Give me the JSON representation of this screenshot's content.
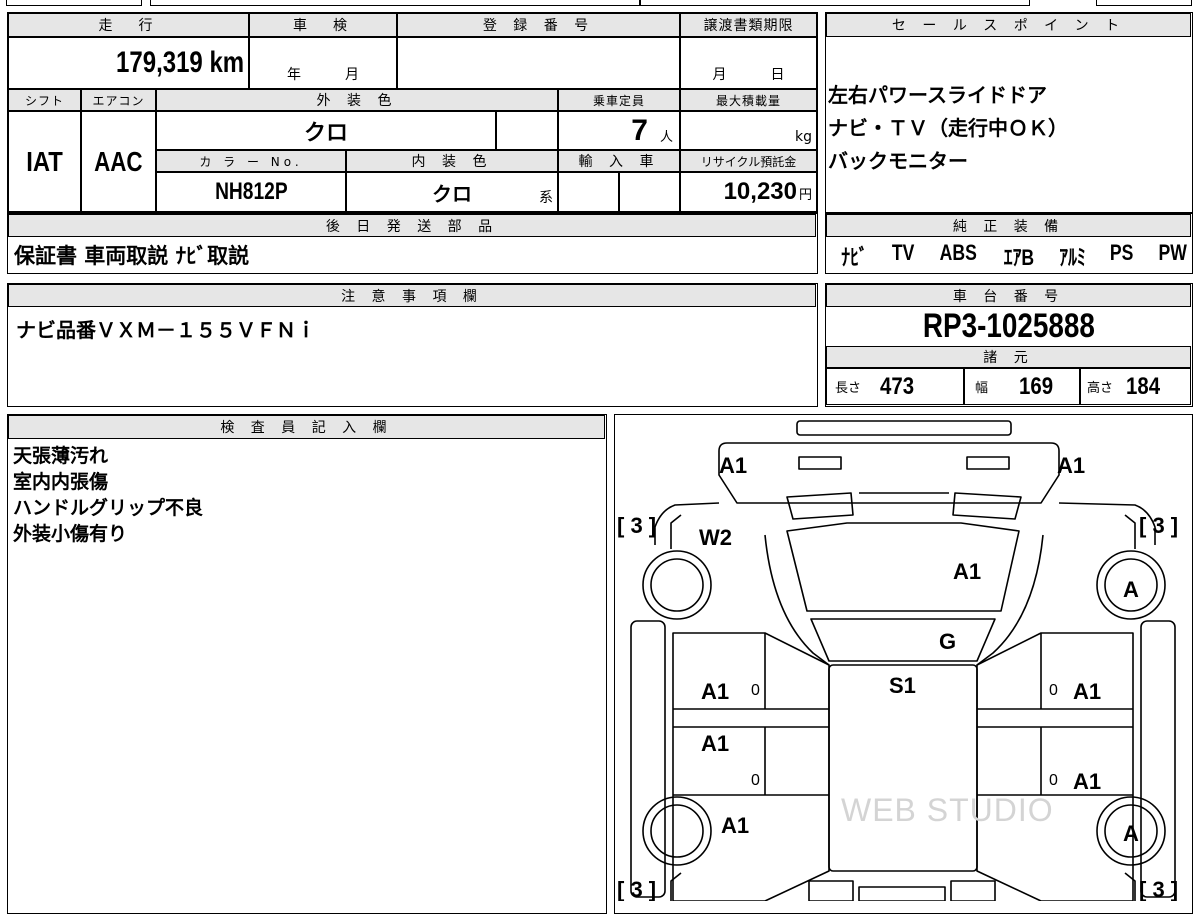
{
  "top_sheet": {
    "mileage_header": "走　行",
    "mileage_value": "179,319 km",
    "shaken_header": "車　検",
    "shaken_year_unit": "年",
    "shaken_month_unit": "月",
    "reg_header": "登 録 番 号",
    "transfer_header": "譲渡書類期限",
    "transfer_month_unit": "月",
    "transfer_day_unit": "日",
    "shift_header": "シフト",
    "shift_value": "IAT",
    "ac_header": "エアコン",
    "ac_value": "AAC",
    "ext_color_header": "外 装 色",
    "ext_color_value": "クロ",
    "capacity_header": "乗車定員",
    "capacity_value": "7",
    "capacity_unit": "人",
    "max_load_header": "最大積載量",
    "max_load_unit": "kg",
    "color_no_header": "カ ラ ー No.",
    "color_no_value": "NH812P",
    "int_color_header": "内 装 色",
    "int_color_value": "クロ",
    "int_color_suffix": "系",
    "import_header": "輸 入 車",
    "recycle_header": "リサイクル預託金",
    "recycle_value": "10,230",
    "recycle_unit": "円"
  },
  "sales_points": {
    "header": "セ ー ル ス ポ イ ン ト",
    "lines": [
      "左右パワースライドドア",
      "ナビ・ＴＶ（走行中ＯＫ）",
      "バックモニター"
    ]
  },
  "later_parts": {
    "header": "後 日 発 送 部 品",
    "value": "保証書 車両取説 ﾅﾋﾞ取説"
  },
  "genuine_equipment": {
    "header": "純 正 装 備",
    "items": [
      "ﾅﾋﾞ",
      "TV",
      "ABS",
      "ｴｱB",
      "ｱﾙﾐ",
      "PS",
      "PW"
    ]
  },
  "notes": {
    "header": "注 意 事 項 欄",
    "value": "ナビ品番ＶＸＭ－１５５ＶＦＮｉ"
  },
  "chassis": {
    "header": "車 台 番 号",
    "value": "RP3-1025888"
  },
  "specs": {
    "header": "諸 元",
    "length_label": "長さ",
    "length_value": "473",
    "width_label": "幅",
    "width_value": "169",
    "height_label": "高さ",
    "height_value": "184"
  },
  "inspector": {
    "header": "検 査 員 記 入 欄",
    "lines": [
      "天張薄汚れ",
      "室内内張傷",
      "ハンドルグリップ不良",
      "外装小傷有り"
    ]
  },
  "diagram": {
    "tire_front_left": "[ 3 ]",
    "tire_front_right": "[ 3 ]",
    "tire_rear_left": "[ 3 ]",
    "tire_rear_right": "[ 3 ]",
    "mark_mirror_left": "A1",
    "mark_mirror_right": "A1",
    "mark_windshield": "W2",
    "mark_hood": "A1",
    "mark_windshield_glass": "G",
    "mark_roof": "S1",
    "mark_front_door_left": "A1",
    "mark_front_door_left_zero": "0",
    "mark_rear_door_left": "A1",
    "mark_rear_door_left_zero": "0",
    "mark_front_door_right": "A1",
    "mark_front_door_right_zero": "0",
    "mark_rear_door_right": "A1",
    "mark_rear_door_right_zero": "0",
    "mark_rear_left": "A1",
    "wheel_front_right": "A",
    "wheel_rear_right": "A",
    "watermark": "WEB STUDIO"
  }
}
